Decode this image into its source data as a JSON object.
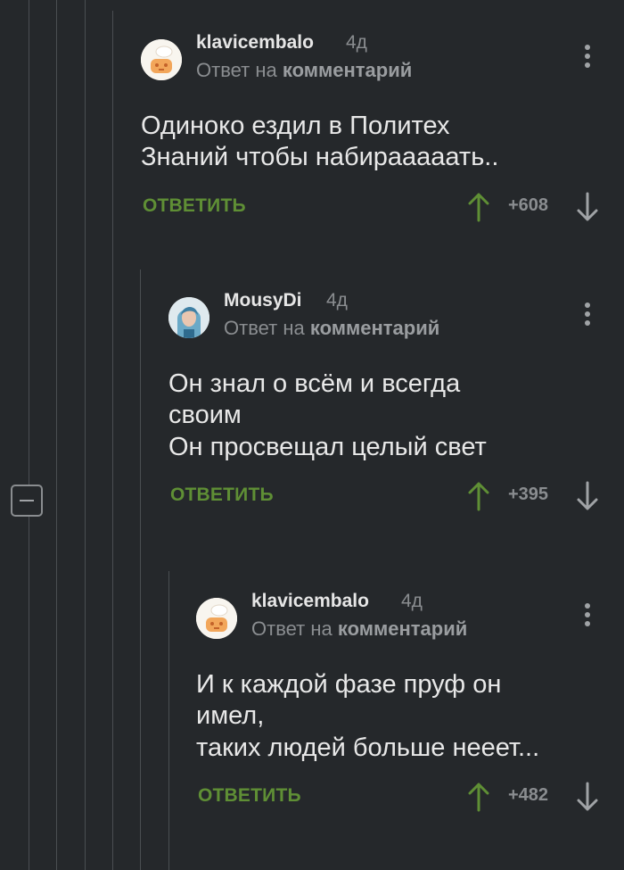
{
  "colors": {
    "background": "#25282b",
    "accent_green": "#5f8f35",
    "muted": "#8a8d90",
    "text": "#e8e8e8"
  },
  "comments": [
    {
      "username": "klavicembalo",
      "time": "4д",
      "reply_prefix": "Ответ на",
      "reply_link": "комментарий",
      "body": [
        "Одиноко ездил в Политех",
        "Знаний чтобы набирааааать.."
      ],
      "reply_label": "ОТВЕТИТЬ",
      "rating": "+608",
      "avatar_icon": "chef-avatar-icon"
    },
    {
      "username": "MousyDi",
      "time": "4д",
      "reply_prefix": "Ответ на",
      "reply_link": "комментарий",
      "body": [
        "Он знал о всём и всегда",
        "своим",
        "Он просвещал целый свет"
      ],
      "reply_label": "ОТВЕТИТЬ",
      "rating": "+395",
      "avatar_icon": "portrait-avatar-icon"
    },
    {
      "username": "klavicembalo",
      "time": "4д",
      "reply_prefix": "Ответ на",
      "reply_link": "комментарий",
      "body": [
        "И к каждой фазе пруф он",
        "имел,",
        "таких людей больше нееет..."
      ],
      "reply_label": "ОТВЕТИТЬ",
      "rating": "+482",
      "avatar_icon": "chef-avatar-icon"
    }
  ]
}
